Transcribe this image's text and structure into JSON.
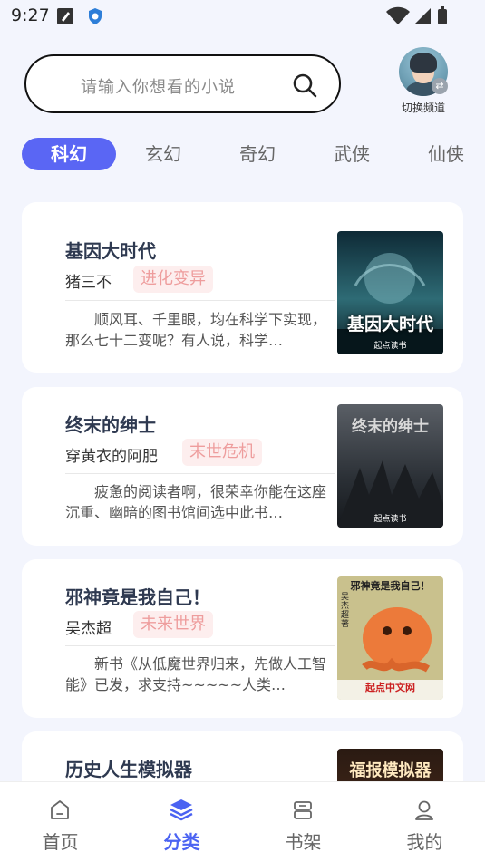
{
  "status_bar": {
    "time": "9:27"
  },
  "search": {
    "placeholder": "请输入你想看的小说"
  },
  "channel_switch": {
    "label": "切换频道"
  },
  "tabs": [
    {
      "label": "科幻",
      "active": true
    },
    {
      "label": "玄幻",
      "active": false
    },
    {
      "label": "奇幻",
      "active": false
    },
    {
      "label": "武侠",
      "active": false
    },
    {
      "label": "仙侠",
      "active": false
    }
  ],
  "books": [
    {
      "title": "基因大时代",
      "author": "猪三不",
      "tag": "进化变异",
      "description": "顺风耳、千里眼，均在科学下实现，那么七十二变呢？有人说，科学…",
      "cover_title": "基因大时代",
      "cover_publisher": "起点读书",
      "cover_color": "#1d3b45"
    },
    {
      "title": "终末的绅士",
      "author": "穿黄衣的阿肥",
      "tag": "末世危机",
      "description": "疲惫的阅读者啊，很荣幸你能在这座沉重、幽暗的图书馆间选中此书…",
      "cover_title": "终末的绅士",
      "cover_publisher": "起点读书",
      "cover_color": "#3c4147"
    },
    {
      "title": "邪神竟是我自己！",
      "author": "吴杰超",
      "tag": "未来世界",
      "description": "新书《从低魔世界归来，先做人工智能》已发，求支持~~~~~人类…",
      "cover_title": "邪神竟是我自己！",
      "cover_author": "吴杰超著",
      "cover_publisher": "起点中文网",
      "cover_color": "#e9763a"
    },
    {
      "title": "历史人生模拟器",
      "author": "",
      "tag": "",
      "description": "",
      "cover_title": "福报模拟器",
      "cover_color": "#3a2418"
    }
  ],
  "bottom_nav": [
    {
      "label": "首页",
      "icon": "home-icon",
      "active": false
    },
    {
      "label": "分类",
      "icon": "layers-icon",
      "active": true
    },
    {
      "label": "书架",
      "icon": "bookshelf-icon",
      "active": false
    },
    {
      "label": "我的",
      "icon": "user-icon",
      "active": false
    }
  ],
  "colors": {
    "accent": "#5a66f4",
    "tag_bg": "#fdeeee",
    "tag_text": "#ee9d9d",
    "background": "#f3f5fd"
  }
}
